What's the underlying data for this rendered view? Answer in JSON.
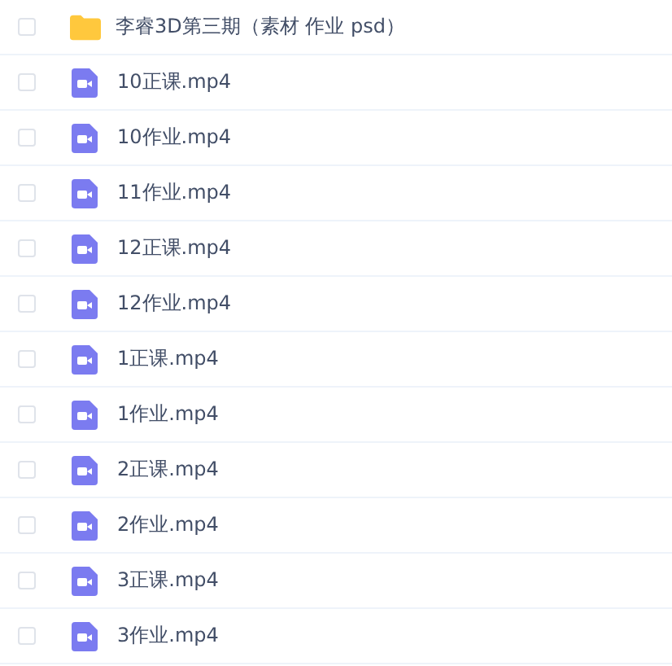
{
  "files": [
    {
      "kind": "folder",
      "name": "李睿3D第三期（素材 作业 psd）",
      "checked": false
    },
    {
      "kind": "video",
      "name": "10正课.mp4",
      "checked": false
    },
    {
      "kind": "video",
      "name": "10作业.mp4",
      "checked": false
    },
    {
      "kind": "video",
      "name": "11作业.mp4",
      "checked": false
    },
    {
      "kind": "video",
      "name": "12正课.mp4",
      "checked": false
    },
    {
      "kind": "video",
      "name": "12作业.mp4",
      "checked": false
    },
    {
      "kind": "video",
      "name": "1正课.mp4",
      "checked": false
    },
    {
      "kind": "video",
      "name": "1作业.mp4",
      "checked": false
    },
    {
      "kind": "video",
      "name": "2正课.mp4",
      "checked": false
    },
    {
      "kind": "video",
      "name": "2作业.mp4",
      "checked": false
    },
    {
      "kind": "video",
      "name": "3正课.mp4",
      "checked": false
    },
    {
      "kind": "video",
      "name": "3作业.mp4",
      "checked": false
    }
  ]
}
